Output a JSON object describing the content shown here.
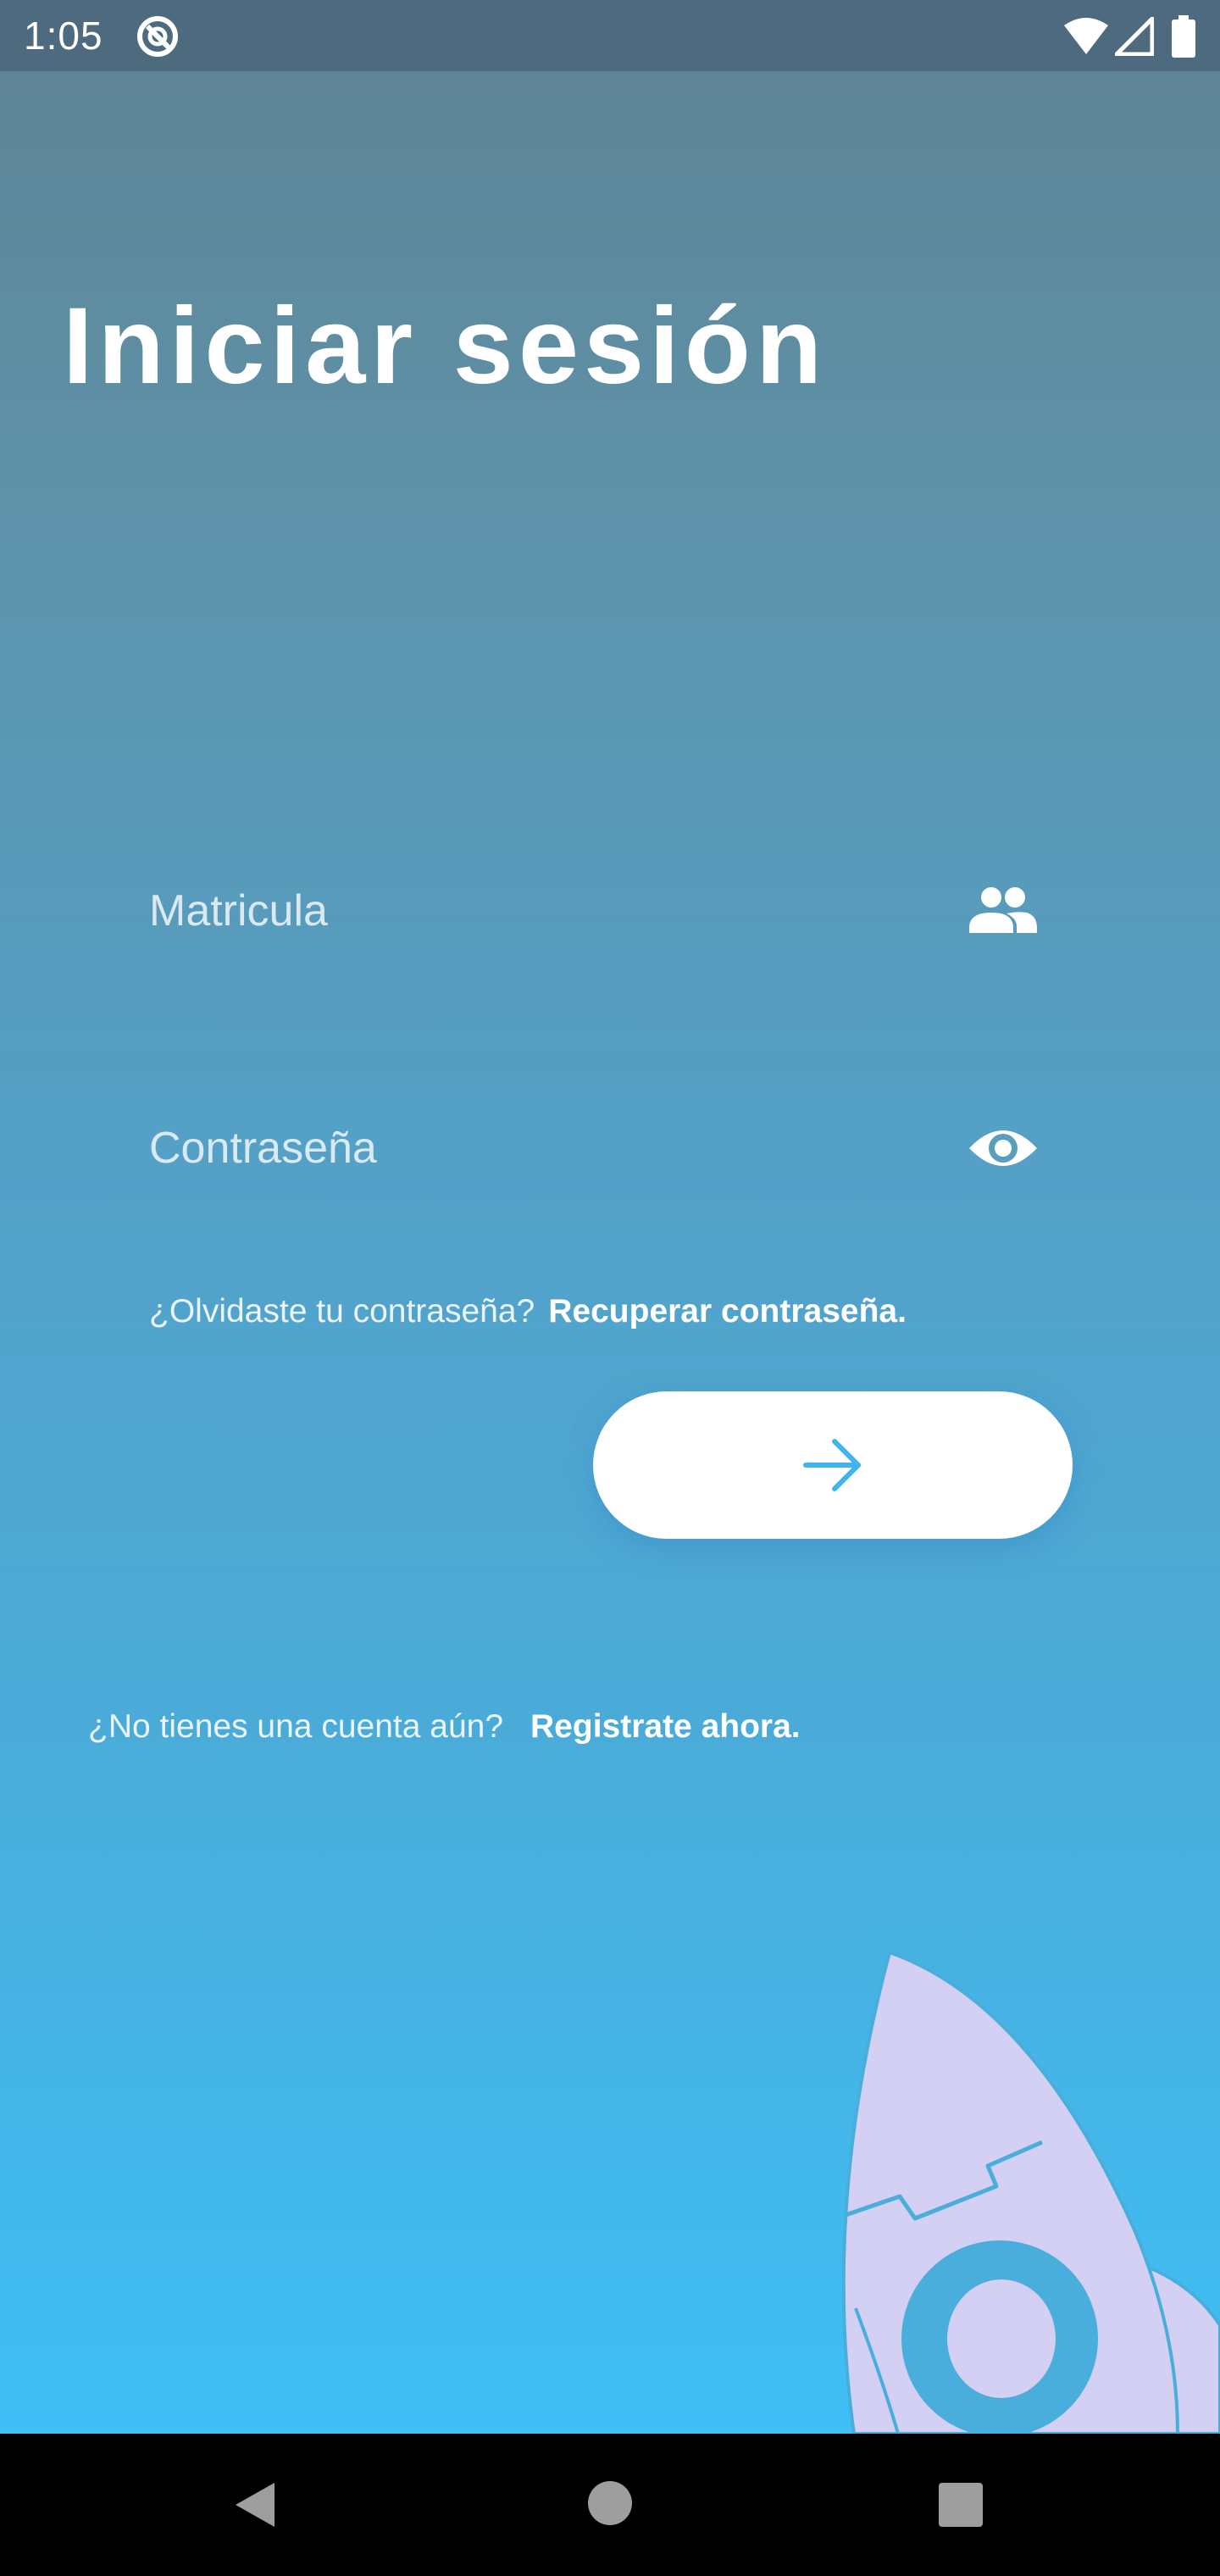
{
  "status_bar": {
    "time": "1:05",
    "icons": [
      "sync-icon",
      "wifi-icon",
      "signal-icon",
      "battery-icon"
    ]
  },
  "login": {
    "title": "Iniciar sesión",
    "username": {
      "placeholder": "Matricula",
      "value": "",
      "icon": "people-icon"
    },
    "password": {
      "placeholder": "Contraseña",
      "value": "",
      "icon": "eye-icon"
    },
    "forgot_prompt": "¿Olvidaste tu contraseña?",
    "forgot_link": "Recuperar contraseña.",
    "submit_icon": "arrow-right-icon",
    "register_prompt": "¿No tienes una cuenta aún?",
    "register_link": "Registrate ahora."
  },
  "illustration": {
    "icon": "rocket-icon"
  },
  "nav_bar": {
    "icons": [
      "back-icon",
      "home-icon",
      "recents-icon"
    ]
  },
  "colors": {
    "status_bar": "#4e6a7f",
    "gradient_top": "#5f8596",
    "gradient_bottom": "#3fbff6",
    "accent": "#3fb4ee",
    "rocket": "#d4d0f3",
    "button": "#ffffff"
  }
}
